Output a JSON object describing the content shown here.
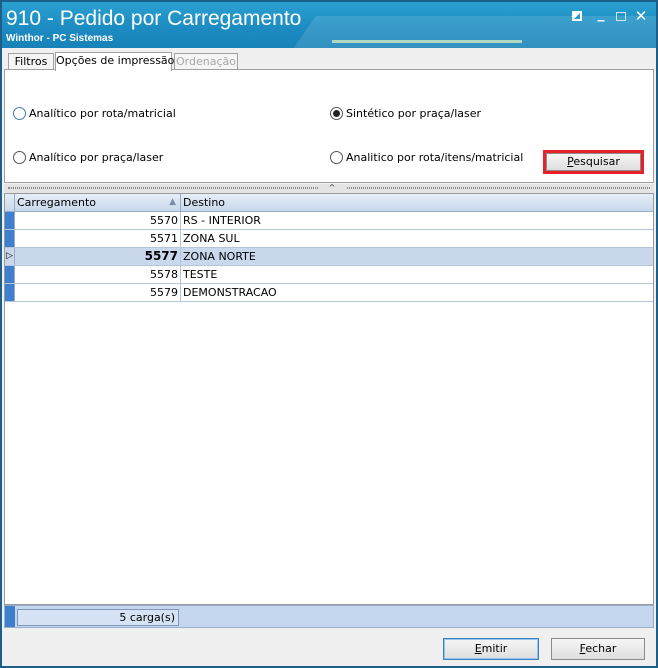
{
  "window": {
    "title": "910 - Pedido por Carregamento",
    "subtitle": "Winthor - PC Sistemas",
    "close_glyph": "✕",
    "minimize_glyph": "_"
  },
  "tabs": [
    {
      "label": "Filtros",
      "active": false,
      "enabled": true
    },
    {
      "label": "Opções de impressão",
      "active": true,
      "enabled": true
    },
    {
      "label": "Ordenação",
      "active": false,
      "enabled": false
    }
  ],
  "options": {
    "analitico_rota_matricial": {
      "label": "Analítico por rota/matricial",
      "checked": false
    },
    "sintetico_praca_laser": {
      "label": "Sintético por praça/laser",
      "checked": true
    },
    "analitico_praca_laser": {
      "label": "Analítico por praça/laser",
      "checked": false
    },
    "analitico_rota_itens_matricial": {
      "label": "Analitico por rota/itens/matricial",
      "checked": false
    }
  },
  "buttons": {
    "pesquisar": {
      "accel": "P",
      "rest": "esquisar"
    },
    "emitir": {
      "accel": "E",
      "rest": "mitir"
    },
    "fechar": {
      "accel": "F",
      "rest": "echar"
    }
  },
  "grid": {
    "columns": [
      "Carregamento",
      "Destino"
    ],
    "sort_glyph": "▲",
    "focus_glyph": "▷",
    "rows": [
      {
        "carregamento": "5570",
        "destino": "RS - INTERIOR"
      },
      {
        "carregamento": "5571",
        "destino": "ZONA SUL"
      },
      {
        "carregamento": "5577",
        "destino": "ZONA NORTE",
        "focused": true
      },
      {
        "carregamento": "5578",
        "destino": "TESTE"
      },
      {
        "carregamento": "5579",
        "destino": "DEMONSTRACAO"
      }
    ],
    "summary": "5 carga(s)"
  },
  "colors": {
    "titlebar": "#1d8cc2",
    "highlight_border": "#e8202a",
    "row_indicator": "#3f7fd0",
    "focused_row": "#c9d8ec"
  }
}
